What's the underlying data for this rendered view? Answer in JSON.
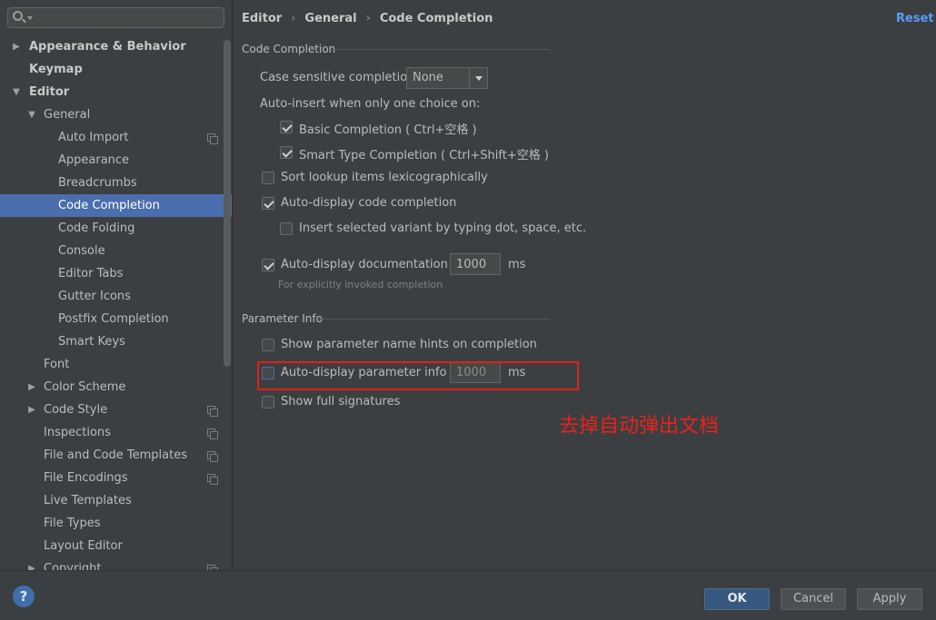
{
  "search": {
    "placeholder": "",
    "value": ""
  },
  "sidebar": {
    "items": [
      {
        "label": "Appearance & Behavior",
        "expander": "▶"
      },
      {
        "label": "Keymap"
      },
      {
        "label": "Editor",
        "expander": "▼"
      },
      {
        "label": "General",
        "expander": "▼"
      },
      {
        "label": "Auto Import"
      },
      {
        "label": "Appearance"
      },
      {
        "label": "Breadcrumbs"
      },
      {
        "label": "Code Completion"
      },
      {
        "label": "Code Folding"
      },
      {
        "label": "Console"
      },
      {
        "label": "Editor Tabs"
      },
      {
        "label": "Gutter Icons"
      },
      {
        "label": "Postfix Completion"
      },
      {
        "label": "Smart Keys"
      },
      {
        "label": "Font"
      },
      {
        "label": "Color Scheme",
        "expander": "▶"
      },
      {
        "label": "Code Style",
        "expander": "▶"
      },
      {
        "label": "Inspections"
      },
      {
        "label": "File and Code Templates"
      },
      {
        "label": "File Encodings"
      },
      {
        "label": "Live Templates"
      },
      {
        "label": "File Types"
      },
      {
        "label": "Layout Editor"
      },
      {
        "label": "Copyright",
        "expander": "▶"
      }
    ]
  },
  "breadcrumb": {
    "part1": "Editor",
    "part2": "General",
    "part3": "Code Completion",
    "separator": "›"
  },
  "reset_label": "Reset",
  "code_completion": {
    "group_title": "Code Completion",
    "case_sensitive_label": "Case sensitive completion:",
    "case_sensitive_value": "None",
    "auto_insert_label": "Auto-insert when only one choice on:",
    "basic_completion": {
      "label": "Basic Completion ( Ctrl+空格 )",
      "checked": true
    },
    "smart_type_completion": {
      "label": "Smart Type Completion ( Ctrl+Shift+空格 )",
      "checked": true
    },
    "sort_lookup": {
      "label": "Sort lookup items lexicographically",
      "checked": false
    },
    "auto_display_code": {
      "label": "Auto-display code completion",
      "checked": true
    },
    "insert_selected": {
      "label": "Insert selected variant by typing dot, space, etc.",
      "checked": false
    },
    "auto_display_doc": {
      "label": "Auto-display documentation in",
      "checked": true,
      "value": "1000",
      "unit": "ms"
    },
    "doc_hint": "For explicitly invoked completion"
  },
  "parameter_info": {
    "group_title": "Parameter Info",
    "show_hints": {
      "label": "Show parameter name hints on completion",
      "checked": false
    },
    "auto_display_param": {
      "label": "Auto-display parameter info in",
      "checked": false,
      "value": "1000",
      "unit": "ms"
    },
    "show_full_signatures": {
      "label": "Show full signatures",
      "checked": false
    }
  },
  "annotation": {
    "text": "去掉自动弹出文档",
    "color": "#e8231b"
  },
  "buttons": {
    "ok": "OK",
    "cancel": "Cancel",
    "apply": "Apply",
    "help": "?"
  },
  "colors": {
    "selection": "#4b6eaf",
    "link": "#589df6",
    "annotation_box": "#e0201a",
    "ok_button": "#365880"
  }
}
